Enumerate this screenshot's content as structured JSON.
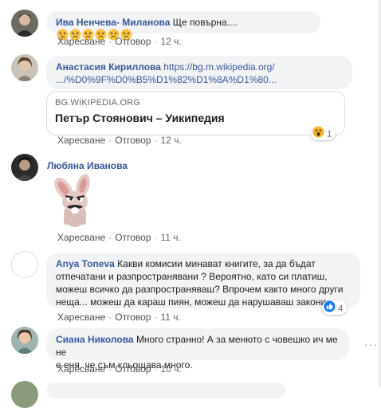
{
  "comments": [
    {
      "author": "Ива Ненчева- Миланова",
      "text": "Ще повърна....",
      "emoji_count": 6,
      "like": "Харесване",
      "reply": "Отговор",
      "time": "12 ч."
    },
    {
      "author": "Анастасия Кириллова",
      "link_line1": "https://bg.m.wikipedia.org/",
      "link_line2": ".../%D0%9F%D0%B5%D1%82%D1%8A%D1%80...",
      "preview_domain": "BG.WIKIPEDIA.ORG",
      "preview_title": "Петър Стоянович – Уикипедия",
      "reaction_count": "1",
      "reaction_icon": "wow-icon",
      "like": "Харесване",
      "reply": "Отговор",
      "time": "12 ч."
    },
    {
      "author": "Любяна Иванова",
      "sticker": "bunny-sticker",
      "like": "Харесване",
      "reply": "Отговор",
      "time": "11 ч."
    },
    {
      "author": "Anya Toneva",
      "text_l1": "Какви комисии минават книгите, за да бъдат",
      "text_l2": "отпечатани и разпространявани ? Вероятно, като си платиш,",
      "text_l3": "можеш всичко да разпространяваш? Впрочем както много други",
      "text_l4": "неща... можеш да караш пиян, можеш да нарушаваш закони. ..",
      "reaction_count": "4",
      "reaction_icon": "like-icon",
      "like": "Харесване",
      "reply": "Отговор",
      "time": "11 ч."
    },
    {
      "author": "Сиана Николова",
      "text_l1": "Много странно! А за менюто с човешко ич ме не",
      "text_l2": "е еня, че съм кльощава много.",
      "edit": "···",
      "like": "Харесване",
      "reply": "Отговор",
      "time": "10 ч."
    }
  ],
  "colors": {
    "author": "#385898",
    "bubble": "#f2f3f5",
    "meta": "#606770"
  }
}
